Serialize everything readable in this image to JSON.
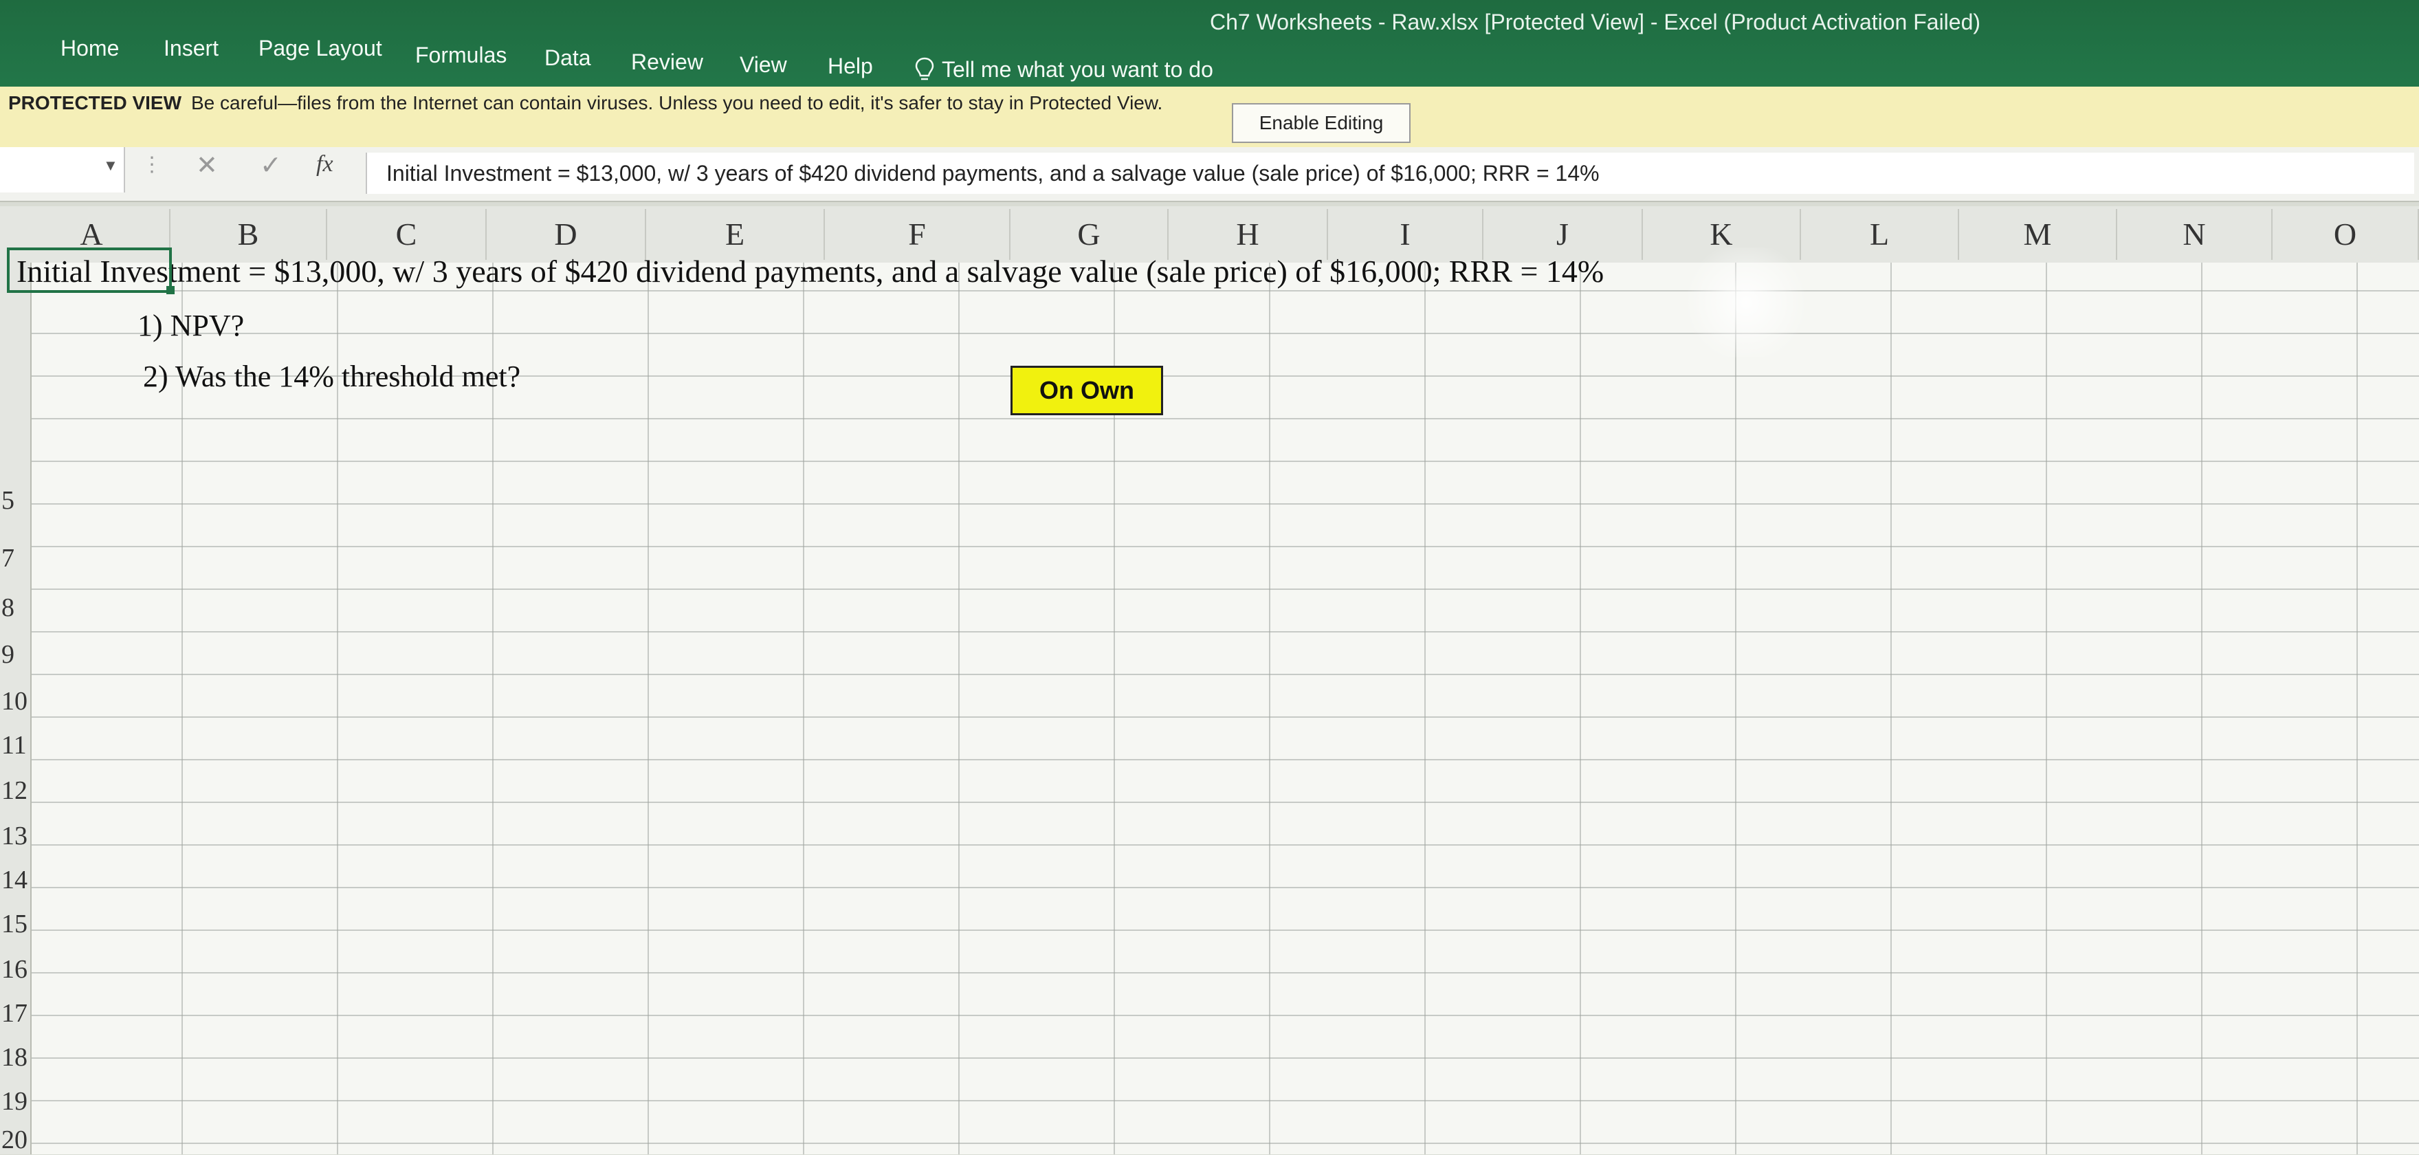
{
  "window": {
    "title": "Ch7 Worksheets - Raw.xlsx  [Protected View]  -  Excel (Product Activation Failed)"
  },
  "ribbon": {
    "tabs": [
      "Home",
      "Insert",
      "Page Layout",
      "Formulas",
      "Data",
      "Review",
      "View",
      "Help"
    ],
    "tell_me": "Tell me what you want to do"
  },
  "protected_view": {
    "title": "PROTECTED VIEW",
    "message": "Be careful—files from the Internet can contain viruses. Unless you need to edit, it's safer to stay in Protected View.",
    "button": "Enable Editing"
  },
  "formula_bar": {
    "fx": "fx",
    "content": "Initial Investment = $13,000, w/ 3 years of $420 dividend payments, and a salvage value (sale price) of $16,000; RRR = 14%"
  },
  "columns": [
    "A",
    "B",
    "C",
    "D",
    "E",
    "F",
    "G",
    "H",
    "I",
    "J",
    "K",
    "L",
    "M",
    "N",
    "O"
  ],
  "rows": [
    "5",
    "7",
    "8",
    "9",
    "10",
    "11",
    "12",
    "13",
    "14",
    "15",
    "16",
    "17",
    "18",
    "19",
    "20"
  ],
  "cells": {
    "a1": "Initial Investment = $13,000, w/ 3 years of $420 dividend payments, and a salvage value (sale price) of $16,000; RRR = 14%",
    "b2": "1) NPV?",
    "b3": "2) Was the 14% threshold met?",
    "on_own": "On Own"
  },
  "colors": {
    "ribbon": "#217346",
    "protected_bar": "#f5efb8",
    "on_own_fill": "#f1f10e"
  }
}
